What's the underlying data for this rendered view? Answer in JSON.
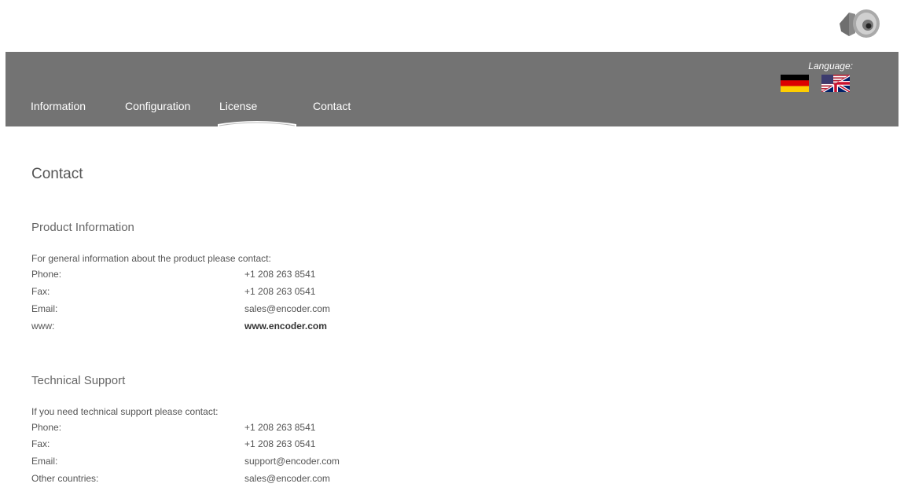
{
  "header": {
    "device_image": "rotary-encoder-image",
    "language_label": "Language:",
    "flags": [
      "german-flag-icon",
      "uk-us-flag-icon"
    ]
  },
  "nav": {
    "items": [
      {
        "label": "Information"
      },
      {
        "label": "Configuration"
      },
      {
        "label": "License"
      },
      {
        "label": "Contact"
      }
    ],
    "active_index": 2
  },
  "main": {
    "title": "Contact",
    "sections": [
      {
        "title": "Product Information",
        "intro": "For general information about the product please contact:",
        "rows": [
          {
            "label": "Phone:",
            "value": "+1 208 263 8541"
          },
          {
            "label": "Fax:",
            "value": "+1 208 263 0541"
          },
          {
            "label": "Email:",
            "value": "sales@encoder.com"
          },
          {
            "label": "www:",
            "value": "www.encoder.com"
          }
        ]
      },
      {
        "title": "Technical Support",
        "intro": "If you need technical support please contact:",
        "rows": [
          {
            "label": "Phone:",
            "value": "+1 208 263 8541"
          },
          {
            "label": "Fax:",
            "value": "+1 208 263 0541"
          },
          {
            "label": "Email:",
            "value": "support@encoder.com"
          },
          {
            "label": "Other countries:",
            "value": "sales@encoder.com"
          }
        ]
      }
    ]
  },
  "colors": {
    "navbar_bg": "#737373",
    "nav_text": "#ffffff",
    "body_text": "#555555"
  }
}
